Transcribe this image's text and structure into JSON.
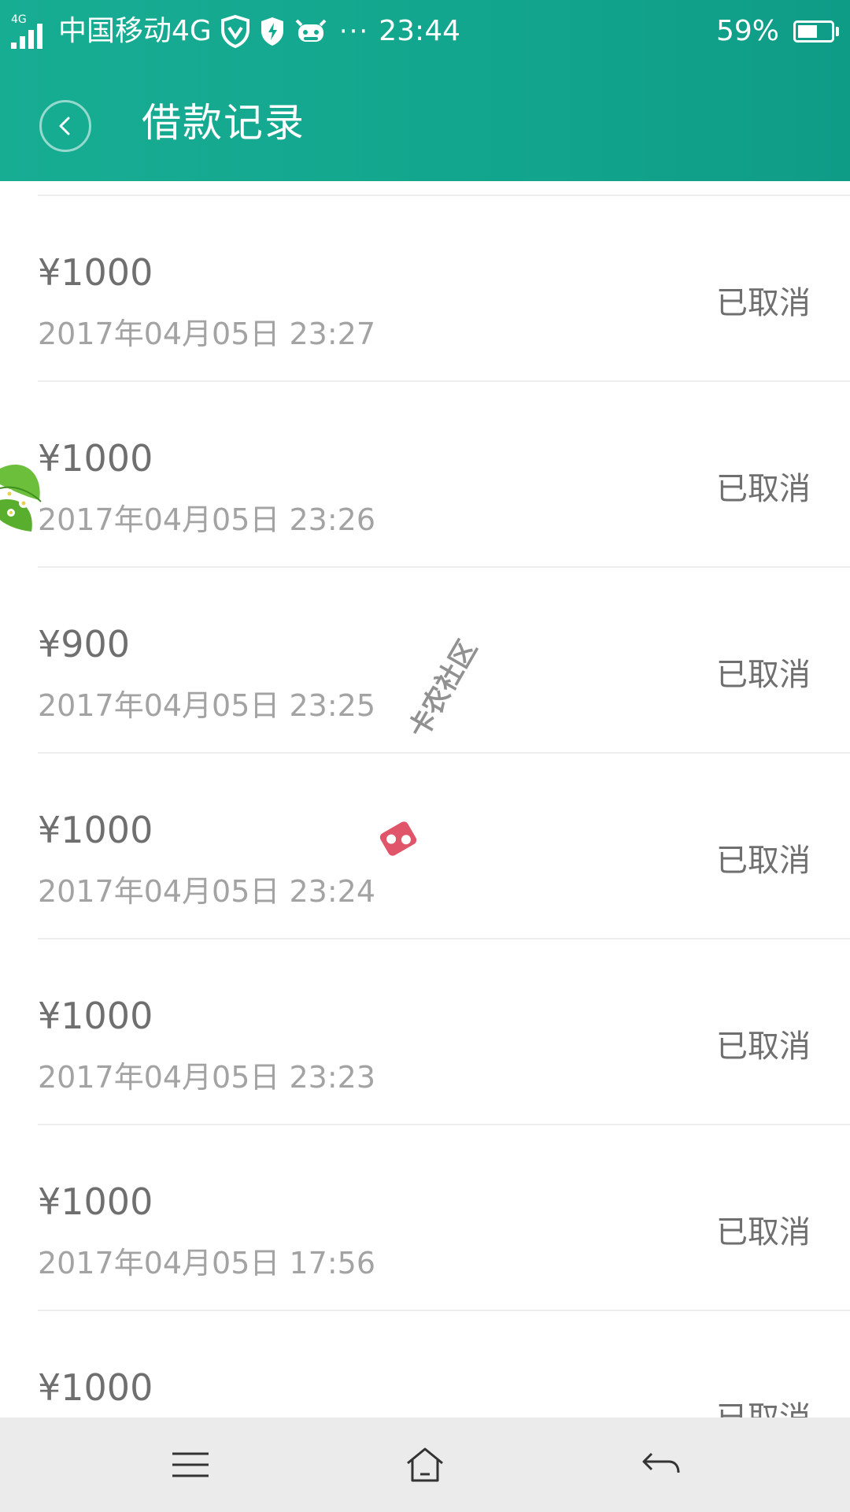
{
  "status_bar": {
    "network_tag": "4G",
    "carrier": "中国移动4G",
    "more": "···",
    "time": "23:44",
    "battery_text": "59%",
    "battery_level": 0.59
  },
  "header": {
    "title": "借款记录",
    "color": "#15a890"
  },
  "records": [
    {
      "amount": "¥1000",
      "time": "2017年04月05日 23:27",
      "status": "已取消"
    },
    {
      "amount": "¥1000",
      "time": "2017年04月05日 23:26",
      "status": "已取消"
    },
    {
      "amount": "¥900",
      "time": "2017年04月05日 23:25",
      "status": "已取消"
    },
    {
      "amount": "¥1000",
      "time": "2017年04月05日 23:24",
      "status": "已取消"
    },
    {
      "amount": "¥1000",
      "time": "2017年04月05日 23:23",
      "status": "已取消"
    },
    {
      "amount": "¥1000",
      "time": "2017年04月05日 17:56",
      "status": "已取消"
    },
    {
      "amount": "¥1000",
      "time": "",
      "status": "已取消"
    }
  ],
  "watermark": {
    "text": "卡农社区"
  },
  "icons": {
    "back": "chevron-left-icon",
    "menu": "menu-icon",
    "home": "home-icon",
    "nav_back": "return-icon"
  }
}
